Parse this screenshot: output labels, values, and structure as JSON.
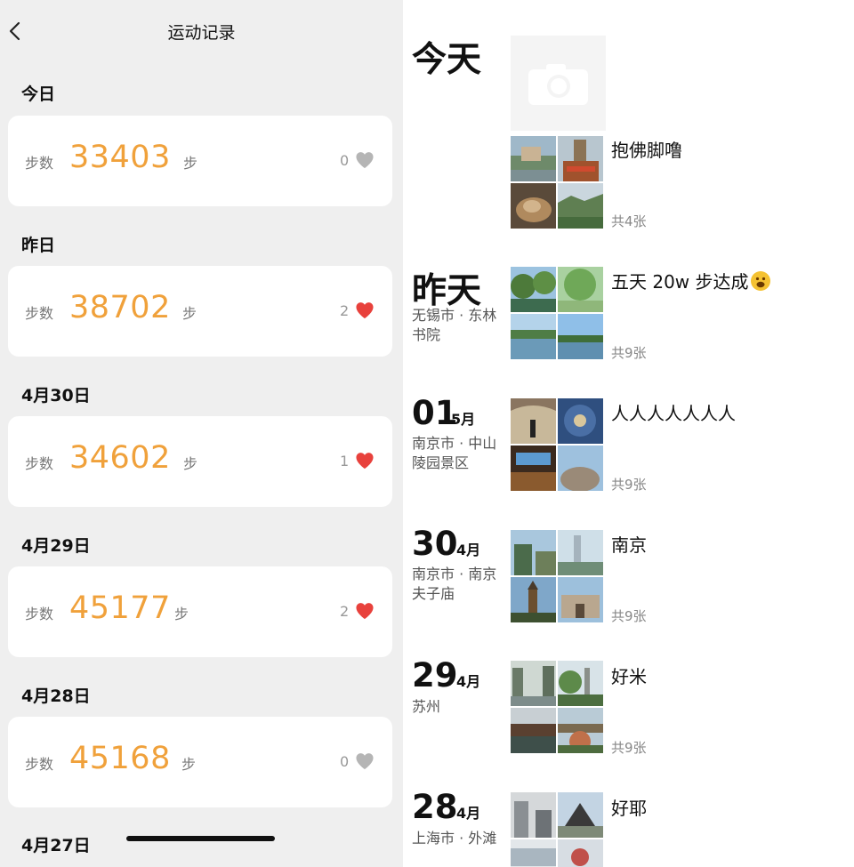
{
  "left": {
    "title": "运动记录",
    "days": [
      {
        "heading": "今日",
        "label": "步数",
        "steps": "33403",
        "unit": "步",
        "likes": "0",
        "liked": false
      },
      {
        "heading": "昨日",
        "label": "步数",
        "steps": "38702",
        "unit": "步",
        "likes": "2",
        "liked": true
      },
      {
        "heading": "4月30日",
        "label": "步数",
        "steps": "34602",
        "unit": "步",
        "likes": "1",
        "liked": true
      },
      {
        "heading": "4月29日",
        "label": "步数",
        "steps": "45177",
        "unit": "步",
        "likes": "2",
        "liked": true
      },
      {
        "heading": "4月28日",
        "label": "步数",
        "steps": "45168",
        "unit": "步",
        "likes": "0",
        "liked": false
      }
    ],
    "next_heading": "4月27日"
  },
  "right": {
    "posts": [
      {
        "day": "今天",
        "caption": "抱佛脚噜",
        "count": "共4张"
      },
      {
        "day": "昨天",
        "location": "无锡市 · 东林书院",
        "caption": "五天 20w 步达成",
        "count": "共9张"
      },
      {
        "date": "01",
        "month": "5月",
        "location": "南京市 · 中山陵园景区",
        "caption": "人人人人人人人",
        "count": "共9张"
      },
      {
        "date": "30",
        "month": "4月",
        "location": "南京市 · 南京夫子庙",
        "caption": "南京",
        "count": "共9张"
      },
      {
        "date": "29",
        "month": "4月",
        "location": "苏州",
        "caption": "好米",
        "count": "共9张"
      },
      {
        "date": "28",
        "month": "4月",
        "location": "上海市 · 外滩",
        "caption": "好耶"
      }
    ]
  },
  "colors": {
    "accent": "#f0a13b",
    "heart_red": "#e8413c",
    "heart_grey": "#b5b5b5",
    "left_bg": "#efefef"
  }
}
